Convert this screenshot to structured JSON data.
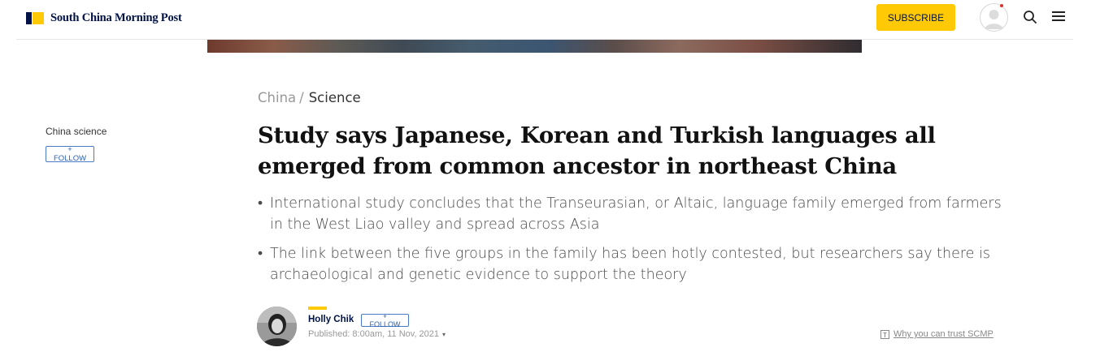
{
  "header": {
    "logo_text": "South China Morning Post",
    "subscribe_label": "SUBSCRIBE",
    "icons": [
      "user-avatar-icon",
      "search-icon",
      "menu-icon"
    ],
    "brand_colors": {
      "navy": "#001246",
      "yellow": "#ffca05",
      "notification": "#e0312b"
    }
  },
  "breadcrumb": {
    "section": "China",
    "separator": "/",
    "subsection": "Science"
  },
  "sidebar": {
    "topic": "China science",
    "follow_label": "+ FOLLOW"
  },
  "article": {
    "headline": "Study says Japanese, Korean and Turkish languages all emerged from common ancestor in northeast China",
    "summary": [
      "International study concludes that the Transeurasian, or Altaic, language family emerged from farmers in the West Liao valley and spread across Asia",
      "The link between the five groups in the family has been hotly contested, but researchers say there is archaeological and genetic evidence to support the theory"
    ],
    "bullet": "•"
  },
  "author": {
    "name": "Holly Chik",
    "follow_label": "+ FOLLOW",
    "published": "Published: 8:00am, 11 Nov, 2021",
    "caret": "▾"
  },
  "trust": {
    "icon": "T",
    "label": "Why you can trust SCMP"
  }
}
